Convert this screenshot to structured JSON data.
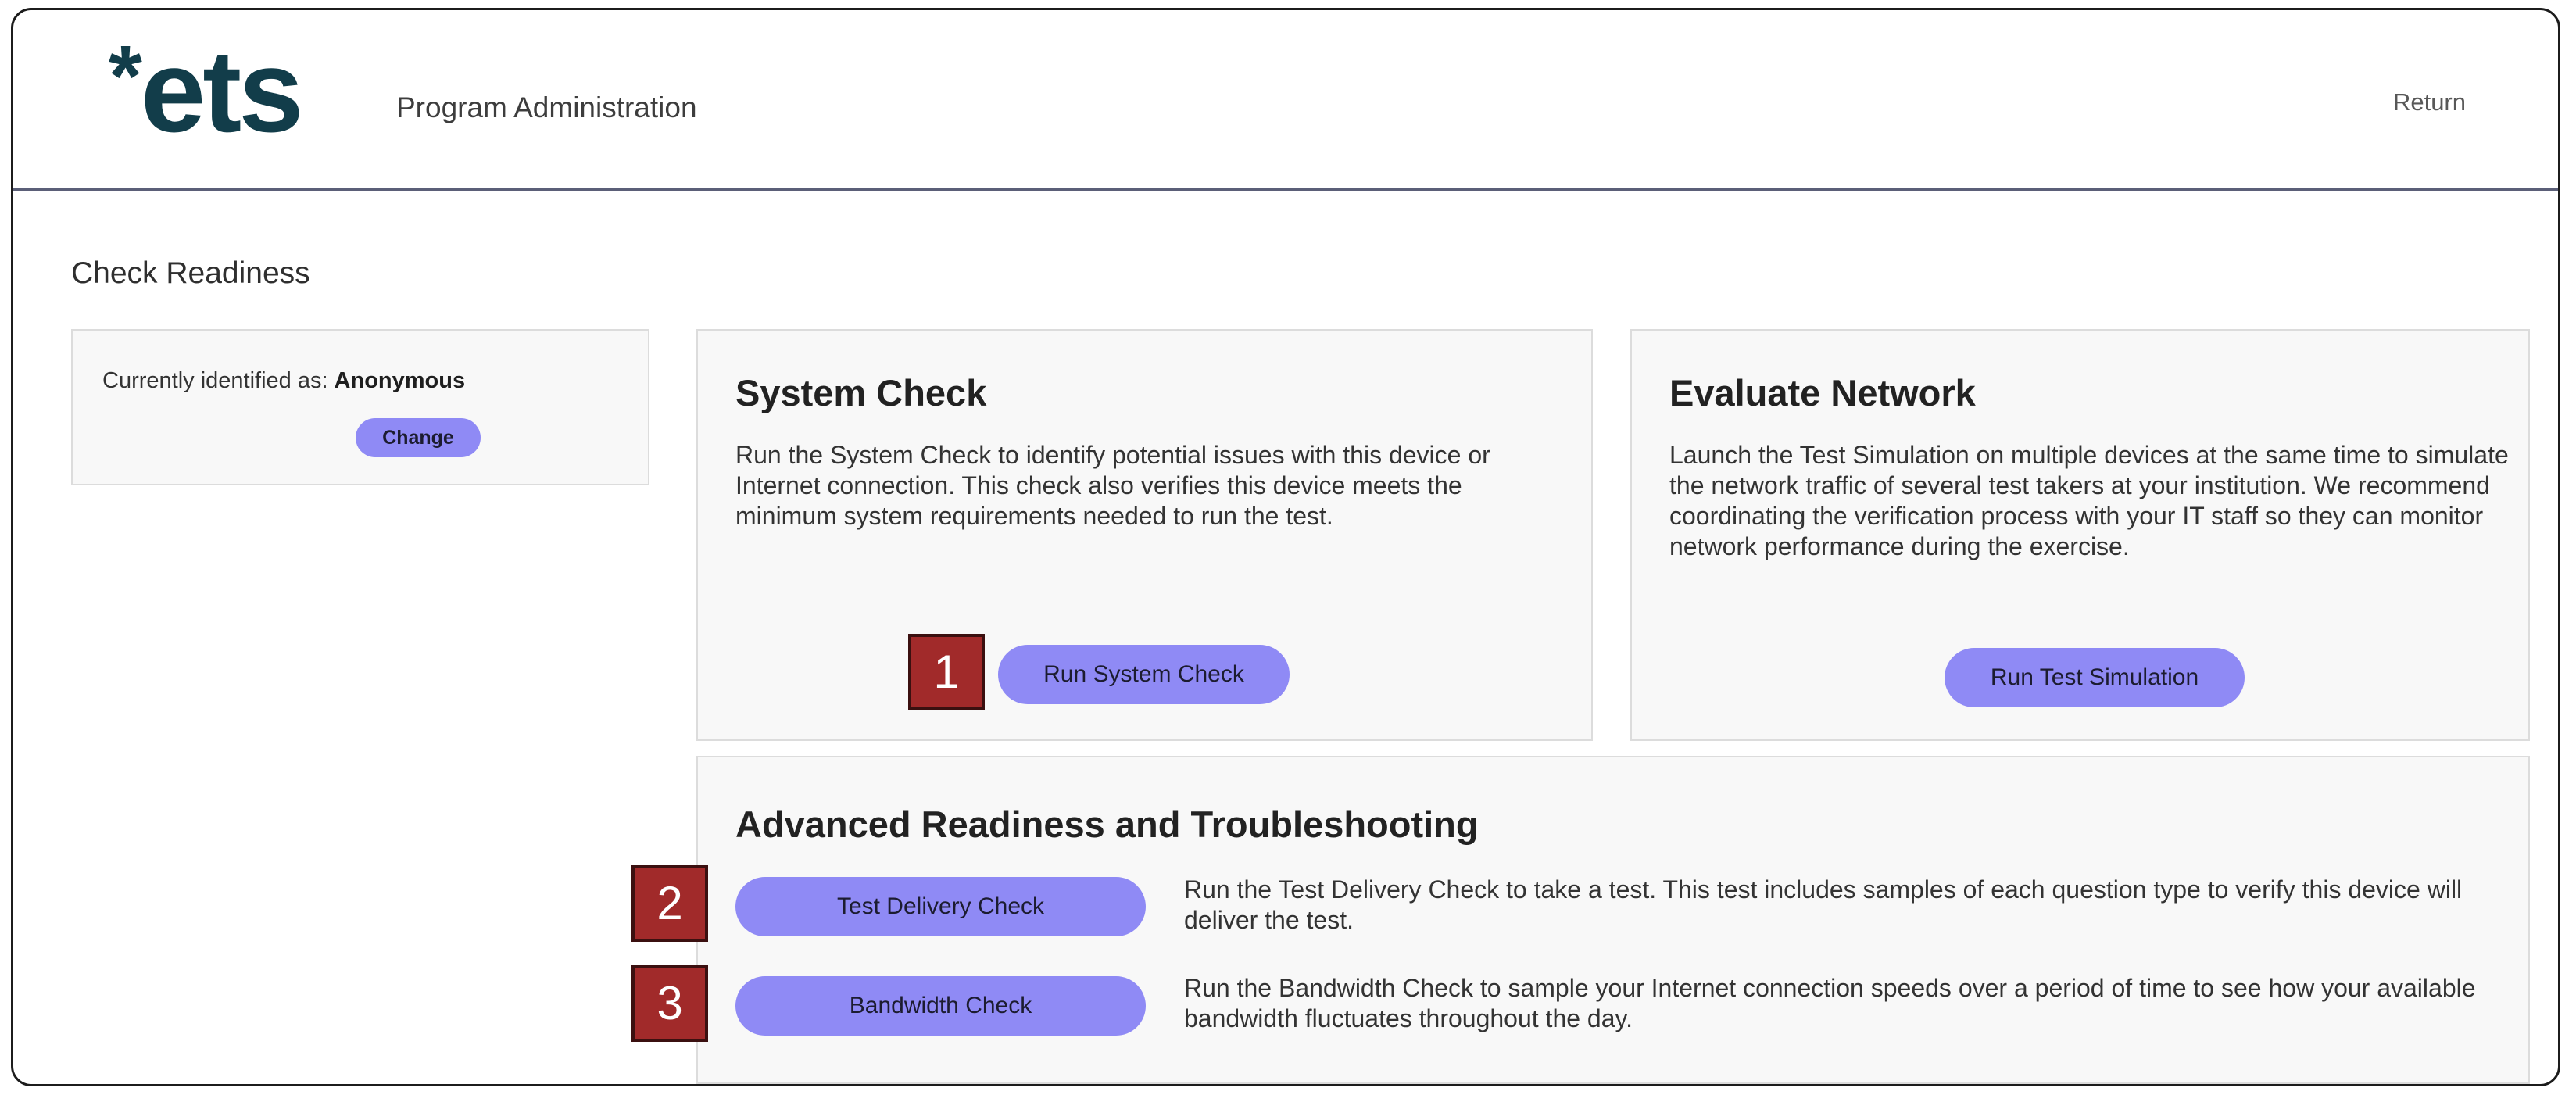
{
  "header": {
    "logo_star": "*",
    "logo_text": "ets",
    "program_label": "Program Administration",
    "return_label": "Return"
  },
  "page": {
    "title": "Check Readiness"
  },
  "identity": {
    "label": "Currently identified as:",
    "value": "Anonymous",
    "change_label": "Change"
  },
  "system_check": {
    "title": "System Check",
    "description": "Run the System Check to identify potential issues with this device or Internet connection. This check also verifies this device meets the minimum system requirements needed to run the test.",
    "button_label": "Run System Check"
  },
  "evaluate_network": {
    "title": "Evaluate Network",
    "description": "Launch the Test Simulation on multiple devices at the same time to simulate the network traffic of several test takers at your institution. We recommend coordinating the verification process with your IT staff so they can monitor network performance during the exercise.",
    "button_label": "Run Test Simulation"
  },
  "advanced": {
    "title": "Advanced Readiness and Troubleshooting",
    "items": [
      {
        "button_label": "Test Delivery Check",
        "description": "Run the Test Delivery Check to take a test. This test includes samples of each question type to verify this device will deliver the test."
      },
      {
        "button_label": "Bandwidth Check",
        "description": "Run the Bandwidth Check to sample your Internet connection speeds over a period of time to see how your available bandwidth fluctuates throughout the day."
      }
    ]
  },
  "markers": [
    "1",
    "2",
    "3"
  ],
  "colors": {
    "button": "#8f8af5",
    "marker": "#a12a2a",
    "logo": "#123d4a",
    "header_rule": "#5b5f78"
  }
}
